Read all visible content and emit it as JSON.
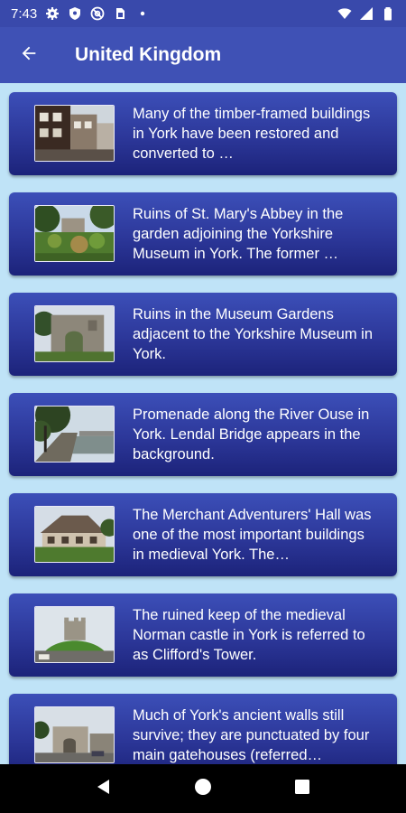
{
  "status_bar": {
    "time": "7:43",
    "icons": [
      "gear-icon",
      "shield-icon",
      "at-sign-icon",
      "sim-card-icon",
      "dot-icon"
    ],
    "right_icons": [
      "wifi-icon",
      "signal-icon",
      "battery-icon"
    ]
  },
  "app_bar": {
    "back_icon": "arrow-left-icon",
    "title": "United Kingdom",
    "color": "#3f51b5"
  },
  "items": [
    {
      "text": "Many of the timber-framed buildings in York have been restored and converted to …",
      "thumb": "timber-houses"
    },
    {
      "text": "Ruins of St. Mary's Abbey in the garden adjoining the Yorkshire Museum in York. The former …",
      "thumb": "abbey-garden"
    },
    {
      "text": "Ruins in the Museum Gardens adjacent to the Yorkshire Museum in York.",
      "thumb": "stone-ruins"
    },
    {
      "text": "Promenade along the River Ouse in York. Lendal Bridge appears in the background.",
      "thumb": "river-promenade"
    },
    {
      "text": "The Merchant Adventurers' Hall was one of the most important buildings in medieval York. The…",
      "thumb": "merchant-hall"
    },
    {
      "text": "The ruined keep of the medieval Norman castle in York is referred to as Clifford's Tower.",
      "thumb": "cliffords-tower"
    },
    {
      "text": "Much of York's ancient walls still survive; they are punctuated by four main gatehouses (referred…",
      "thumb": "city-walls"
    }
  ],
  "nav_bar": {
    "icons": [
      "back-triangle-icon",
      "home-circle-icon",
      "recents-square-icon"
    ]
  }
}
